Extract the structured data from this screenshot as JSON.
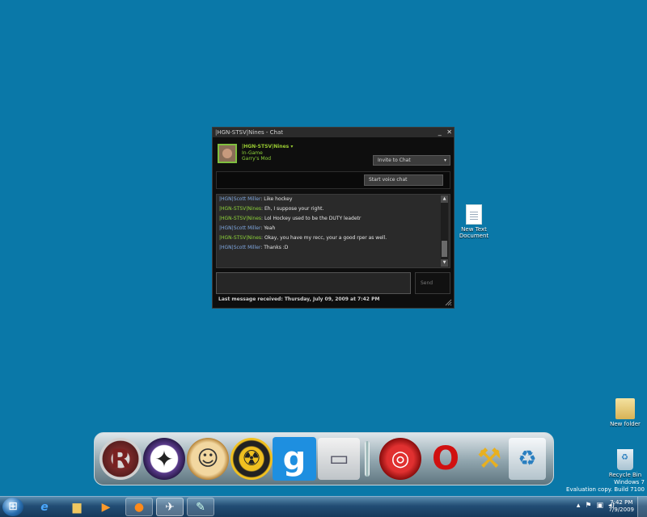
{
  "window": {
    "title": "|HGN-STSV|Nines - Chat",
    "minimize": "_",
    "close": "✕"
  },
  "profile": {
    "name": "|HGN-STSV|Nines",
    "name_caret": "▾",
    "status": "In-Game",
    "game": "Garry's Mod"
  },
  "buttons": {
    "invite": "Invite to Chat",
    "invite_caret": "▾",
    "voice": "Start voice chat",
    "send": "Send"
  },
  "messages": [
    {
      "sender": "|HGN|Scott Miller",
      "kind": "friend",
      "sep": ": ",
      "text": "Like hockey"
    },
    {
      "sender": "|HGN-STSV|Nines",
      "kind": "self",
      "sep": ": ",
      "text": "Eh, I suppose your right."
    },
    {
      "sender": "|HGN-STSV|Nines",
      "kind": "self",
      "sep": ": ",
      "text": "Lol Hockey used to be the DUTY leadetr"
    },
    {
      "sender": "|HGN|Scott Miller",
      "kind": "friend",
      "sep": ": ",
      "text": "Yeah"
    },
    {
      "sender": "|HGN-STSV|Nines",
      "kind": "self",
      "sep": ": ",
      "text": "Okay, you have my recc, your a good rper as well."
    },
    {
      "sender": "|HGN|Scott Miller",
      "kind": "friend",
      "sep": ": ",
      "text": "Thanks :D"
    }
  ],
  "footer": {
    "last_message": "Last message received: Thursday, July 09, 2009 at 7:42 PM"
  },
  "desktop_icons": {
    "text_doc": "New Text Document",
    "folder": "New folder",
    "recycle": "Recycle Bin"
  },
  "watermark": {
    "line1": "Windows 7",
    "line2": "Evaluation copy. Build 7100"
  },
  "dock_icons": [
    "rockstar-icon",
    "counter-strike-icon",
    "fallout-vault-boy-icon",
    "stalker-radiation-icon",
    "garrys-mod-icon",
    "monitor-icon",
    "separator",
    "swirl-icon",
    "opera-icon",
    "tools-icon",
    "recycle-bin-icon"
  ],
  "clock": {
    "time": "7:42 PM",
    "date": "7/9/2009"
  },
  "colors": {
    "desktop": "#0a78a8",
    "self_name": "#8ed43a",
    "friend_name": "#7fa6de"
  }
}
